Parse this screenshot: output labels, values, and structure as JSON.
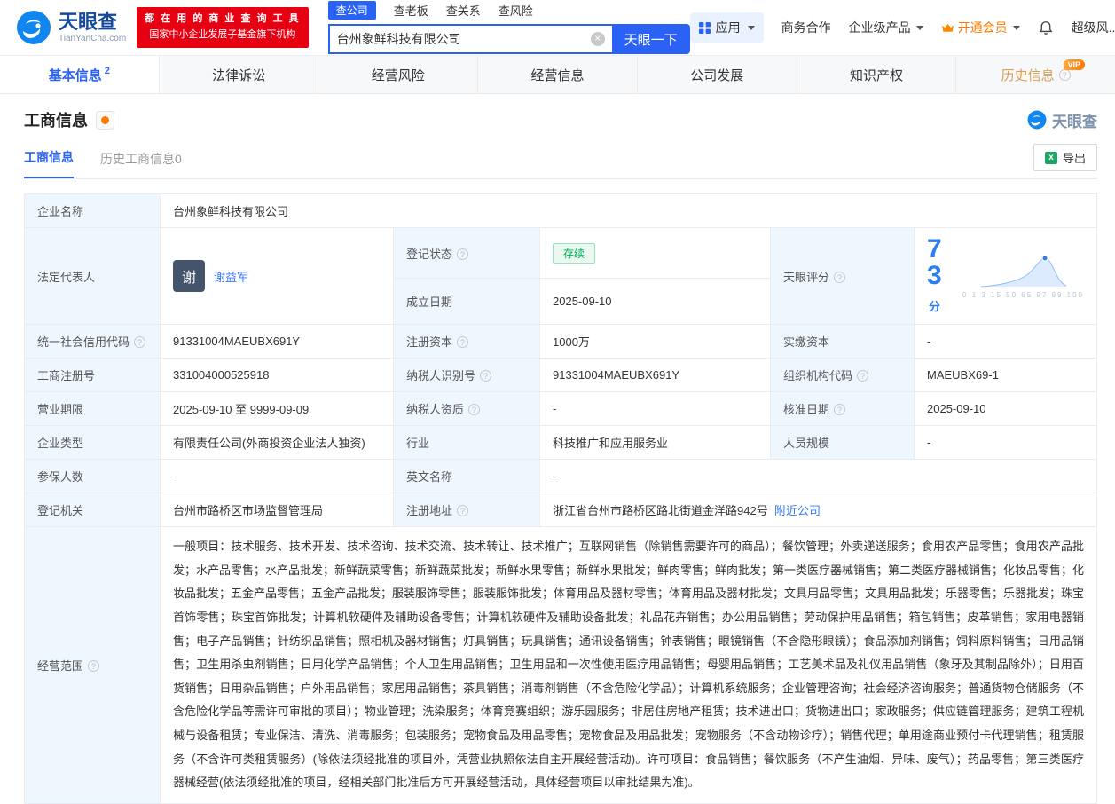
{
  "colors": {
    "primary_blue": "#2b62f6",
    "badge_red": "#e60012",
    "status_green": "#00b159",
    "vip_orange": "#ff7a00",
    "history_gold": "#d6a055"
  },
  "header": {
    "logo": {
      "title": "天眼查",
      "subtitle": "TianYanCha.com"
    },
    "promo": {
      "line1": "都 在 用 的 商 业 查 询 工 具",
      "line2": "国家中小企业发展子基金旗下机构"
    },
    "search": {
      "tabs": [
        {
          "label": "查公司",
          "active": true
        },
        {
          "label": "查老板"
        },
        {
          "label": "查关系"
        },
        {
          "label": "查风险"
        }
      ],
      "value": "台州象鲜科技有限公司",
      "button": "天眼一下"
    },
    "menu": {
      "apps": "应用",
      "cooperation": "商务合作",
      "enterprise": "企业级产品",
      "vip": "开通会员",
      "super_risk": "超级风..."
    }
  },
  "nav": {
    "tabs": [
      {
        "label": "基本信息",
        "count": "2",
        "active": true
      },
      {
        "label": "法律诉讼"
      },
      {
        "label": "经营风险"
      },
      {
        "label": "经营信息"
      },
      {
        "label": "公司发展"
      },
      {
        "label": "知识产权"
      },
      {
        "label": "历史信息",
        "vip": "VIP"
      }
    ]
  },
  "section": {
    "title": "工商信息",
    "watermark": "天眼查"
  },
  "subtabs": {
    "current": "工商信息",
    "history": "历史工商信息0",
    "export": "导出"
  },
  "score": {
    "value": "73",
    "unit": "分",
    "axis": "0 1 3 15 50 65 97 99 100"
  },
  "fields": {
    "company_name": {
      "label": "企业名称",
      "value": "台州象鲜科技有限公司"
    },
    "legal_rep": {
      "label": "法定代表人",
      "avatar": "谢",
      "value": "谢益军"
    },
    "reg_status": {
      "label": "登记状态",
      "value": "存续"
    },
    "establish_date": {
      "label": "成立日期",
      "value": "2025-09-10"
    },
    "tyc_score": {
      "label": "天眼评分"
    },
    "credit_code": {
      "label": "统一社会信用代码",
      "value": "91331004MAEUBX691Y"
    },
    "reg_capital": {
      "label": "注册资本",
      "value": "1000万"
    },
    "paid_capital": {
      "label": "实缴资本",
      "value": "-"
    },
    "reg_number": {
      "label": "工商注册号",
      "value": "331004000525918"
    },
    "taxpayer_id": {
      "label": "纳税人识别号",
      "value": "91331004MAEUBX691Y"
    },
    "org_code": {
      "label": "组织机构代码",
      "value": "MAEUBX69-1"
    },
    "business_term": {
      "label": "营业期限",
      "value": "2025-09-10 至 9999-09-09"
    },
    "taxpayer_quality": {
      "label": "纳税人资质",
      "value": "-"
    },
    "approval_date": {
      "label": "核准日期",
      "value": "2025-09-10"
    },
    "company_type": {
      "label": "企业类型",
      "value": "有限责任公司(外商投资企业法人独资)"
    },
    "industry": {
      "label": "行业",
      "value": "科技推广和应用服务业"
    },
    "staff_size": {
      "label": "人员规模",
      "value": "-"
    },
    "insured_count": {
      "label": "参保人数",
      "value": "-"
    },
    "english_name": {
      "label": "英文名称",
      "value": "-"
    },
    "reg_authority": {
      "label": "登记机关",
      "value": "台州市路桥区市场监督管理局"
    },
    "reg_address": {
      "label": "注册地址",
      "value": "浙江省台州市路桥区路北街道金洋路942号",
      "nearby": "附近公司"
    },
    "business_scope": {
      "label": "经营范围",
      "value": "一般项目：技术服务、技术开发、技术咨询、技术交流、技术转让、技术推广；互联网销售（除销售需要许可的商品）；餐饮管理；外卖递送服务；食用农产品零售；食用农产品批发；水产品零售；水产品批发；新鲜蔬菜零售；新鲜蔬菜批发；新鲜水果零售；新鲜水果批发；鲜肉零售；鲜肉批发；第一类医疗器械销售；第二类医疗器械销售；化妆品零售；化妆品批发；五金产品零售；五金产品批发；服装服饰零售；服装服饰批发；体育用品及器材零售；体育用品及器材批发；文具用品零售；文具用品批发；乐器零售；乐器批发；珠宝首饰零售；珠宝首饰批发；计算机软硬件及辅助设备零售；计算机软硬件及辅助设备批发；礼品花卉销售；办公用品销售；劳动保护用品销售；箱包销售；皮革销售；家用电器销售；电子产品销售；针纺织品销售；照相机及器材销售；灯具销售；玩具销售；通讯设备销售；钟表销售；眼镜销售（不含隐形眼镜）；食品添加剂销售；饲料原料销售；日用品销售；卫生用杀虫剂销售；日用化学产品销售；个人卫生用品销售；卫生用品和一次性使用医疗用品销售；母婴用品销售；工艺美术品及礼仪用品销售（象牙及其制品除外）；日用百货销售；日用杂品销售；户外用品销售；家居用品销售；茶具销售；消毒剂销售（不含危险化学品）；计算机系统服务；企业管理咨询；社会经济咨询服务；普通货物仓储服务（不含危险化学品等需许可审批的项目）；物业管理；洗染服务；体育竞赛组织；游乐园服务；非居住房地产租赁；技术进出口；货物进出口；家政服务；供应链管理服务；建筑工程机械与设备租赁；专业保洁、清洗、消毒服务；包装服务；宠物食品及用品零售；宠物食品及用品批发；宠物服务（不含动物诊疗）；销售代理；单用途商业预付卡代理销售；租赁服务（不含许可类租赁服务）(除依法须经批准的项目外，凭营业执照依法自主开展经营活动)。许可项目：食品销售；餐饮服务（不产生油烟、异味、废气）；药品零售；第三类医疗器械经营(依法须经批准的项目，经相关部门批准后方可开展经营活动，具体经营项目以审批结果为准)。"
    }
  }
}
